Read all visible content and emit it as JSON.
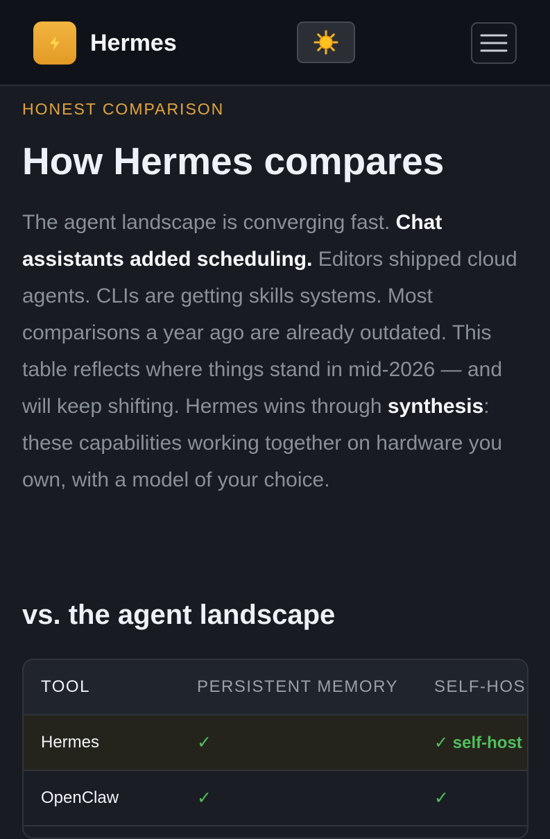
{
  "header": {
    "brand": "Hermes",
    "logo_icon": "lightning-bolt-icon",
    "theme_icon": "sun-icon",
    "menu_icon": "hamburger-menu-icon"
  },
  "hero": {
    "eyebrow": "HONEST COMPARISON",
    "title": "How Hermes compares",
    "intro": [
      "The agent landscape is converging fast. ",
      "Chat assistants added scheduling.",
      " Editors shipped cloud agents. CLIs are getting skills systems. Most comparisons a year ago are already outdated. This table reflects where things stand in mid-2026 — and will keep shifting. Hermes wins through ",
      "synthesis",
      ": these capabilities working together on hardware you own, with a model of your choice."
    ]
  },
  "section": {
    "title": "vs. the agent landscape"
  },
  "table": {
    "headers": [
      "TOOL",
      "PERSISTENT MEMORY",
      "SELF-HOS"
    ],
    "rows": [
      {
        "tool": "Hermes",
        "memory": "✓",
        "self_hosted": "✓ self-host"
      },
      {
        "tool": "OpenClaw",
        "memory": "✓",
        "self_hosted": "✓"
      }
    ]
  },
  "colors": {
    "accent": "#e3a53d",
    "check": "#4fbf5d",
    "background": "#181b21",
    "highlight_row": "#25241c"
  }
}
